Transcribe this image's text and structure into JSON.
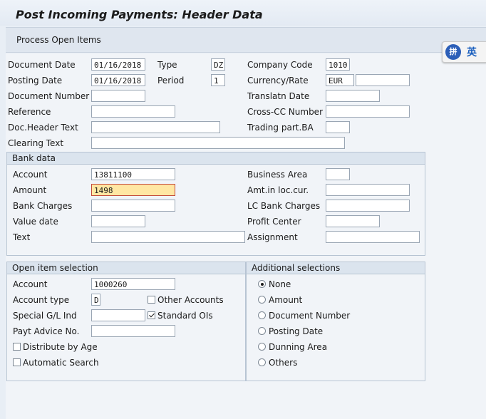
{
  "window": {
    "title": "Post Incoming Payments: Header Data"
  },
  "toolbar": {
    "process_open_items": "Process Open Items"
  },
  "ime": {
    "logo": "拼",
    "text": "英"
  },
  "header": {
    "document_date": {
      "label": "Document Date",
      "value": "01/16/2018"
    },
    "type": {
      "label": "Type",
      "value": "DZ"
    },
    "company_code": {
      "label": "Company Code",
      "value": "1010"
    },
    "posting_date": {
      "label": "Posting Date",
      "value": "01/16/2018"
    },
    "period": {
      "label": "Period",
      "value": "1"
    },
    "currency_rate": {
      "label": "Currency/Rate",
      "value": "EUR",
      "rate": ""
    },
    "document_number": {
      "label": "Document Number",
      "value": ""
    },
    "translation_date": {
      "label": "Translatn Date",
      "value": ""
    },
    "reference": {
      "label": "Reference",
      "value": ""
    },
    "cross_cc_number": {
      "label": "Cross-CC Number",
      "value": ""
    },
    "doc_header_text": {
      "label": "Doc.Header Text",
      "value": ""
    },
    "trading_part_ba": {
      "label": "Trading part.BA",
      "value": ""
    },
    "clearing_text": {
      "label": "Clearing Text",
      "value": ""
    }
  },
  "bank_data": {
    "title": "Bank data",
    "account": {
      "label": "Account",
      "value": "13811100"
    },
    "business_area": {
      "label": "Business Area",
      "value": ""
    },
    "amount": {
      "label": "Amount",
      "value": "1498"
    },
    "amt_loc_cur": {
      "label": "Amt.in loc.cur.",
      "value": ""
    },
    "bank_charges": {
      "label": "Bank Charges",
      "value": ""
    },
    "lc_bank_charges": {
      "label": "LC Bank Charges",
      "value": ""
    },
    "value_date": {
      "label": "Value date",
      "value": ""
    },
    "profit_center": {
      "label": "Profit Center",
      "value": ""
    },
    "text": {
      "label": "Text",
      "value": ""
    },
    "assignment": {
      "label": "Assignment",
      "value": ""
    }
  },
  "open_item_selection": {
    "title": "Open item selection",
    "account": {
      "label": "Account",
      "value": "1000260"
    },
    "account_type": {
      "label": "Account type",
      "value": "D"
    },
    "other_accounts": {
      "label": "Other Accounts",
      "checked": false
    },
    "special_gl": {
      "label": "Special G/L Ind",
      "value": ""
    },
    "standard_ois": {
      "label": "Standard OIs",
      "checked": true
    },
    "payt_advice": {
      "label": "Payt Advice No.",
      "value": ""
    },
    "distribute_by_age": {
      "label": "Distribute by Age",
      "checked": false
    },
    "automatic_search": {
      "label": "Automatic Search",
      "checked": false
    }
  },
  "additional_selections": {
    "title": "Additional selections",
    "options": [
      "None",
      "Amount",
      "Document Number",
      "Posting Date",
      "Dunning Area",
      "Others"
    ],
    "selected": "None"
  }
}
